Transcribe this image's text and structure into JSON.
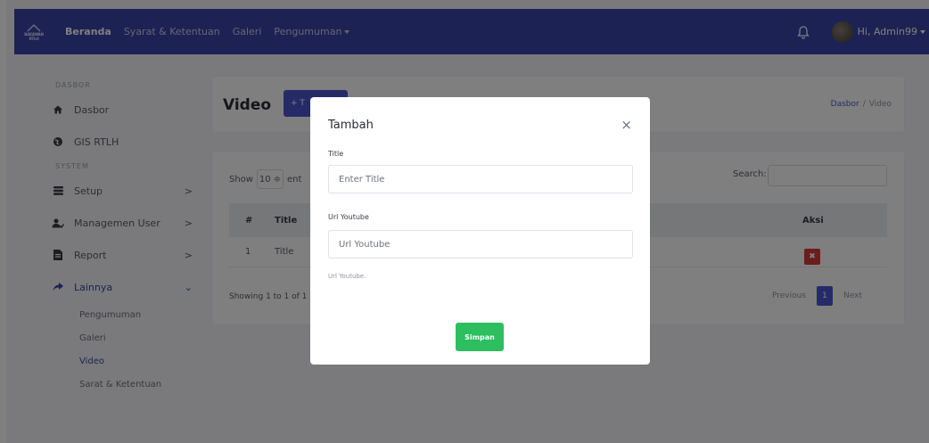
{
  "logo": {
    "line1": "BAKAWAN",
    "line2": "RTLH"
  },
  "nav": {
    "items": [
      {
        "label": "Beranda"
      },
      {
        "label": "Syarat & Ketentuan"
      },
      {
        "label": "Galeri"
      },
      {
        "label": "Pengumuman"
      }
    ],
    "user_label": "Hi, Admin99"
  },
  "sidebar": {
    "heading_dasbor": "DASBOR",
    "heading_system": "SYSTEM",
    "items": [
      {
        "label": "Dasbor",
        "icon": "home-icon"
      },
      {
        "label": "GIS RTLH",
        "icon": "globe-icon"
      },
      {
        "label": "Setup",
        "icon": "list-icon",
        "chevron": ">"
      },
      {
        "label": "Managemen User",
        "icon": "users-icon",
        "chevron": ">"
      },
      {
        "label": "Report",
        "icon": "file-icon",
        "chevron": ">"
      },
      {
        "label": "Lainnya",
        "icon": "share-icon",
        "chevron": "⌄"
      }
    ],
    "sub_items": [
      {
        "label": "Pengumuman"
      },
      {
        "label": "Galeri"
      },
      {
        "label": "Video",
        "active": true
      },
      {
        "label": "Sarat & Ketentuan"
      }
    ]
  },
  "header": {
    "title": "Video",
    "add_button": "+ T",
    "breadcrumb": {
      "parent": "Dasbor",
      "sep": "/",
      "current": "Video"
    }
  },
  "table": {
    "show_label": "Show",
    "show_value": "10 ≑",
    "entries_label": "ent",
    "search_label": "Search:",
    "columns": {
      "num": "#",
      "title": "Title",
      "action": "Aksi"
    },
    "rows": [
      {
        "num": "1",
        "title": "Title",
        "delete": "✖"
      }
    ],
    "info": "Showing 1 to 1 of 1",
    "pagination": {
      "prev": "Previous",
      "page": "1",
      "next": "Next"
    }
  },
  "modal": {
    "title": "Tambah",
    "close": "×",
    "title_label": "Title",
    "title_placeholder": "Enter Title",
    "url_label": "Url Youtube",
    "url_placeholder": "Url Youtube",
    "url_help": "Url Youtube.",
    "save_label": "Simpan"
  },
  "colors": {
    "navbar": "#3a45a8",
    "primary": "#4c56d1",
    "danger": "#d63a3a",
    "success": "#2dbe5f"
  }
}
